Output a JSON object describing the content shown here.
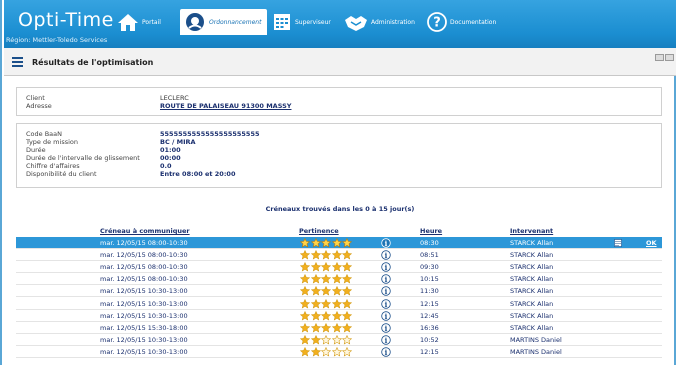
{
  "app": {
    "logo": "Opti-Time",
    "region": "Région: Mettler-Toledo Services"
  },
  "nav": [
    {
      "label": "Portail",
      "icon": "home-icon"
    },
    {
      "label": "Ordonnancement",
      "icon": "planner-icon",
      "active": true
    },
    {
      "label": "Superviseur",
      "icon": "calendar-grid-icon"
    },
    {
      "label": "Administration",
      "icon": "handshake-icon"
    },
    {
      "label": "Documentation",
      "icon": "help-icon"
    }
  ],
  "page": {
    "title": "Résultats de l'optimisation"
  },
  "client_panel": {
    "client_label": "Client",
    "client_value": "LECLERC",
    "address_label": "Adresse",
    "address_value": "ROUTE DE PALAISEAU 91300 MASSY"
  },
  "details_panel": {
    "rows": [
      {
        "label": "Code BaaN",
        "value": "5555555555555555555555"
      },
      {
        "label": "Type de mission",
        "value": "BC / MIRA"
      },
      {
        "label": "Durée",
        "value": "01:00"
      },
      {
        "label": "Durée de l'intervalle de glissement",
        "value": "00:00"
      },
      {
        "label": "Chiffre d'affaires",
        "value": "0.0"
      },
      {
        "label": "Disponibilité du client",
        "value": "Entre 08:00 et 20:00"
      }
    ]
  },
  "slots_caption": "Créneaux trouvés dans les 0 à 15 jour(s)",
  "table": {
    "headers": {
      "slot": "Créneau à communiquer",
      "relevance": "Pertinence",
      "time": "Heure",
      "technician": "Intervenant"
    },
    "ok_label": "OK",
    "rows": [
      {
        "slot": "mar. 12/05/15 08:00-10:30",
        "stars": 5,
        "time": "08:30",
        "technician": "STARCK Allan",
        "selected": true
      },
      {
        "slot": "mar. 12/05/15 08:00-10:30",
        "stars": 5,
        "time": "08:51",
        "technician": "STARCK Allan"
      },
      {
        "slot": "mar. 12/05/15 08:00-10:30",
        "stars": 5,
        "time": "09:30",
        "technician": "STARCK Allan"
      },
      {
        "slot": "mar. 12/05/15 08:00-10:30",
        "stars": 5,
        "time": "10:15",
        "technician": "STARCK Allan"
      },
      {
        "slot": "mar. 12/05/15 10:30-13:00",
        "stars": 5,
        "time": "11:30",
        "technician": "STARCK Allan"
      },
      {
        "slot": "mar. 12/05/15 10:30-13:00",
        "stars": 5,
        "time": "12:15",
        "technician": "STARCK Allan"
      },
      {
        "slot": "mar. 12/05/15 10:30-13:00",
        "stars": 5,
        "time": "12:45",
        "technician": "STARCK Allan"
      },
      {
        "slot": "mar. 12/05/15 15:30-18:00",
        "stars": 5,
        "time": "16:36",
        "technician": "STARCK Allan"
      },
      {
        "slot": "mar. 12/05/15 10:30-13:00",
        "stars": 2,
        "time": "10:52",
        "technician": "MARTINS Daniel"
      },
      {
        "slot": "mar. 12/05/15 10:30-13:00",
        "stars": 2,
        "time": "12:15",
        "technician": "MARTINS Daniel"
      }
    ]
  },
  "colors": {
    "header_blue": "#1b8ed1",
    "selected_row": "#2d97d8",
    "star_gold": "#f2b01e",
    "link_navy": "#1a2f6e"
  }
}
